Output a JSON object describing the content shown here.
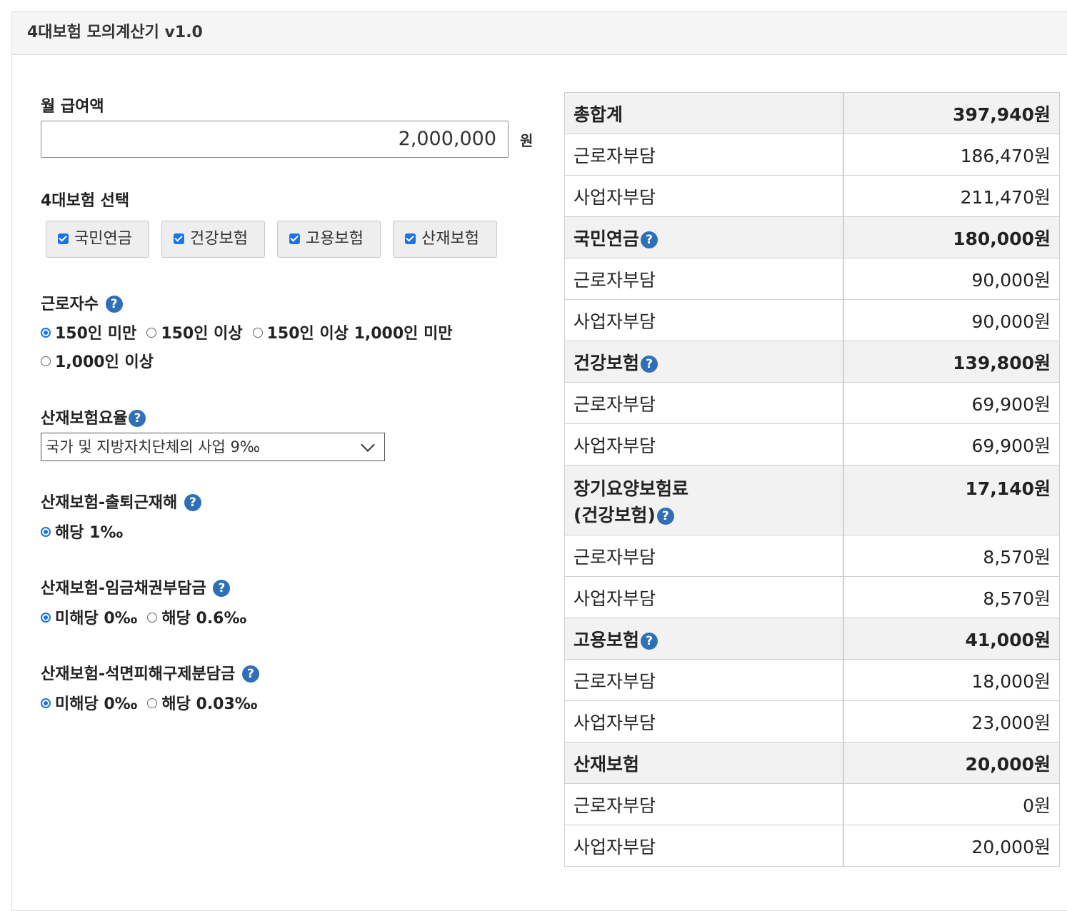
{
  "app": {
    "title": "4대보험 모의계산기 v1.0"
  },
  "salary": {
    "label": "월 급여액",
    "value": "2,000,000",
    "unit": "원"
  },
  "insurance_select": {
    "label": "4대보험 선택",
    "options": [
      {
        "label": "국민연금",
        "checked": true
      },
      {
        "label": "건강보험",
        "checked": true
      },
      {
        "label": "고용보험",
        "checked": true
      },
      {
        "label": "산재보험",
        "checked": true
      }
    ]
  },
  "workers": {
    "label": "근로자수",
    "options": [
      {
        "label": "150인 미만",
        "selected": true
      },
      {
        "label": "150인 이상",
        "selected": false
      },
      {
        "label": "150인 이상 1,000인 미만",
        "selected": false
      },
      {
        "label": "1,000인 이상",
        "selected": false
      }
    ]
  },
  "industrial_rate": {
    "label": "산재보험요율",
    "selected": "국가 및 지방자치단체의 사업 9‰"
  },
  "commute": {
    "label": "산재보험-출퇴근재해",
    "options": [
      {
        "label": "해당 1‰",
        "selected": true
      }
    ]
  },
  "wage_claim": {
    "label": "산재보험-임금채권부담금",
    "options": [
      {
        "label": "미해당 0‰",
        "selected": true
      },
      {
        "label": "해당 0.6‰",
        "selected": false
      }
    ]
  },
  "asbestos": {
    "label": "산재보험-석면피해구제분담금",
    "options": [
      {
        "label": "미해당 0‰",
        "selected": true
      },
      {
        "label": "해당 0.03‰",
        "selected": false
      }
    ]
  },
  "results": {
    "total": {
      "label": "총합계",
      "value": "397,940원"
    },
    "total_worker": {
      "label": "근로자부담",
      "value": "186,470원"
    },
    "total_employer": {
      "label": "사업자부담",
      "value": "211,470원"
    },
    "pension": {
      "label": "국민연금",
      "value": "180,000원",
      "worker": "90,000원",
      "employer": "90,000원"
    },
    "health": {
      "label": "건강보험",
      "value": "139,800원",
      "worker": "69,900원",
      "employer": "69,900원"
    },
    "longterm": {
      "label_line1": "장기요양보험료",
      "label_line2": "(건강보험)",
      "value": "17,140원",
      "worker": "8,570원",
      "employer": "8,570원"
    },
    "employment": {
      "label": "고용보험",
      "value": "41,000원",
      "worker": "18,000원",
      "employer": "23,000원"
    },
    "industrial": {
      "label": "산재보험",
      "value": "20,000원",
      "worker": "0원",
      "employer": "20,000원"
    },
    "worker_label": "근로자부담",
    "employer_label": "사업자부담"
  },
  "help_icon": "question-circle-icon"
}
